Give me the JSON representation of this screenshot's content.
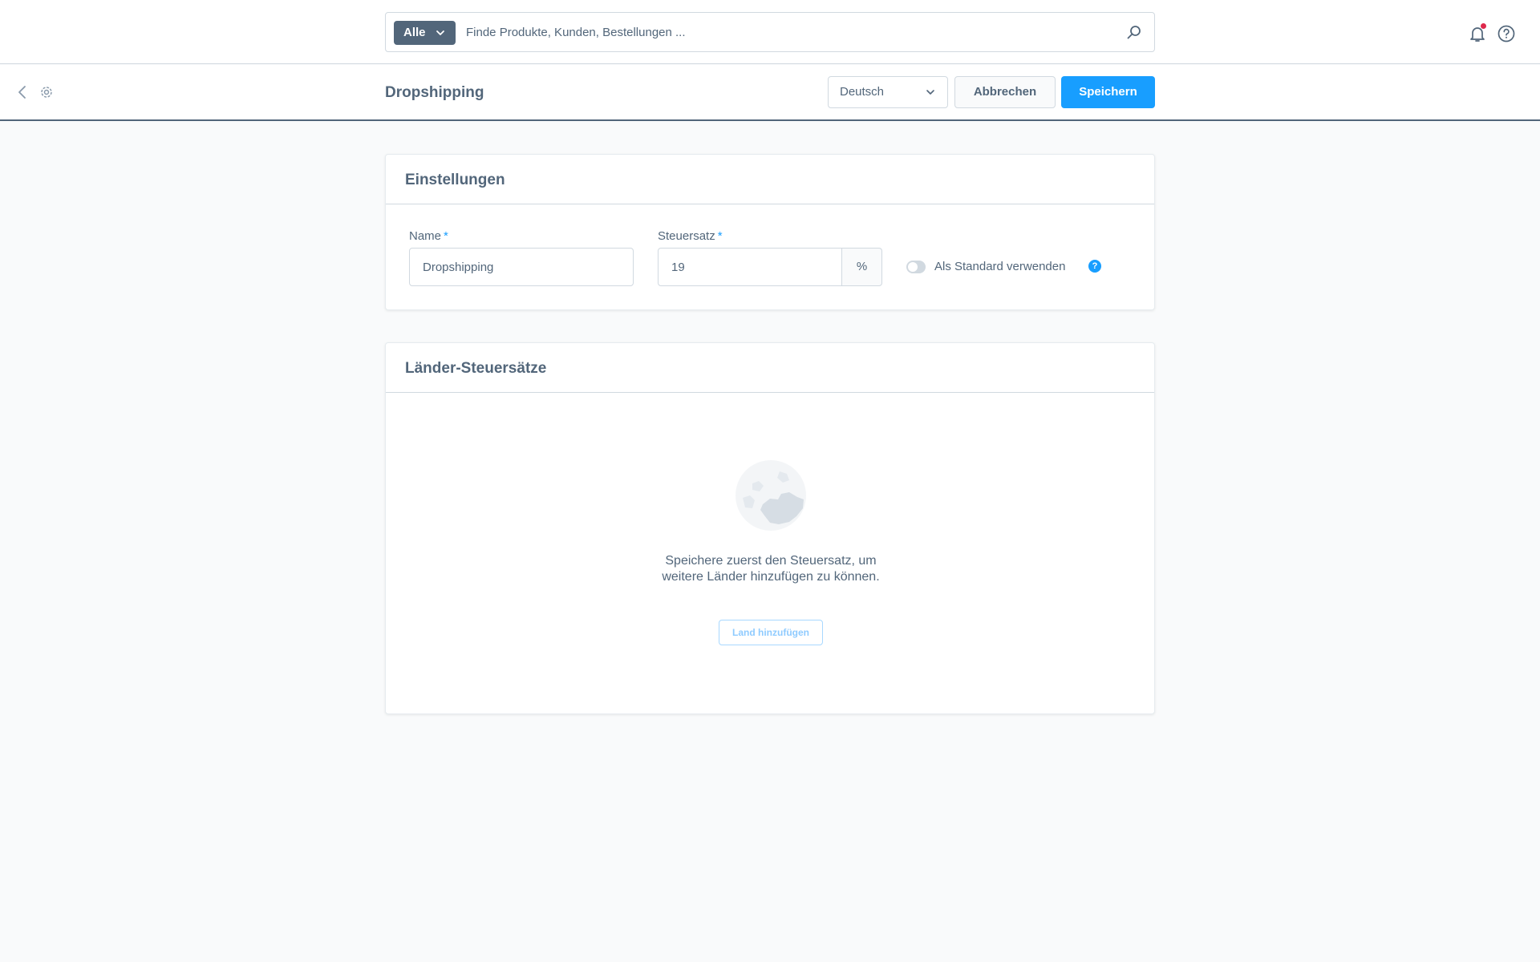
{
  "search": {
    "type_label": "Alle",
    "placeholder": "Finde Produkte, Kunden, Bestellungen ..."
  },
  "smartbar": {
    "title": "Dropshipping",
    "language": "Deutsch",
    "cancel_label": "Abbrechen",
    "save_label": "Speichern"
  },
  "settings_card": {
    "title": "Einstellungen",
    "name_label": "Name",
    "name_value": "Dropshipping",
    "tax_label": "Steuersatz",
    "tax_value": "19",
    "tax_suffix": "%",
    "required_mark": "*",
    "default_toggle_label": "Als Standard verwenden",
    "default_toggle_on": false,
    "help_glyph": "?"
  },
  "countries_card": {
    "title": "Länder-Steuersätze",
    "empty_text": "Speichere zuerst den Steuersatz, um weitere Länder hinzufügen zu können.",
    "add_country_label": "Land hinzufügen"
  },
  "icons": {
    "search_type": "chevron-down-icon",
    "search": "search-icon",
    "notifications": "bell-icon",
    "help": "help-icon",
    "back": "chevron-left-icon",
    "settings": "gear-icon",
    "empty_state": "globe-icon"
  },
  "colors": {
    "primary": "#189eff",
    "text": "#52667a",
    "border": "#d1d9e0",
    "notification_dot": "#de294c",
    "background": "#f9fafb"
  }
}
